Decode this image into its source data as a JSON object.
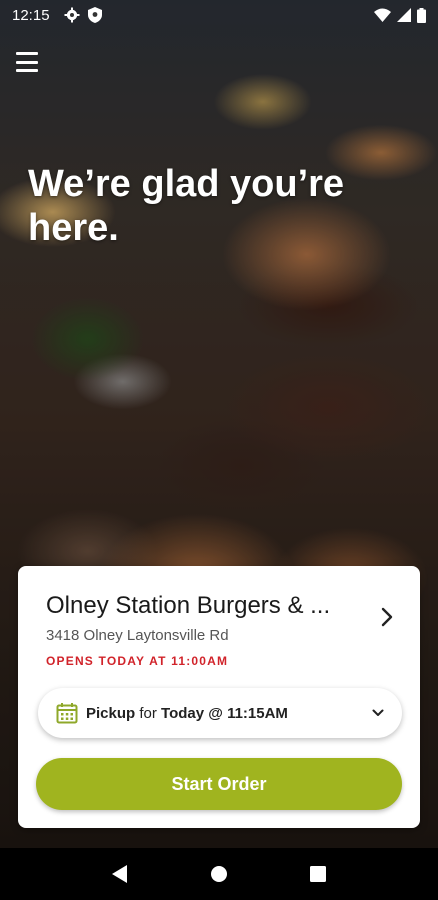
{
  "status_bar": {
    "time": "12:15",
    "left_icons": [
      "gear-icon",
      "shield-icon"
    ],
    "right_icons": [
      "wifi-icon",
      "signal-icon",
      "battery-icon"
    ]
  },
  "header": {
    "menu_icon": "hamburger-menu-icon"
  },
  "hero": {
    "welcome_line1": "We’re glad you’re",
    "welcome_line2": "here."
  },
  "store": {
    "name": "Olney Station Burgers & ...",
    "address": "3418 Olney Laytonsville Rd",
    "hours_status": "OPENS TODAY AT 11:00AM"
  },
  "pickup": {
    "mode": "Pickup",
    "connector": "for",
    "time": "Today @ 11:15AM"
  },
  "actions": {
    "start_order": "Start Order"
  },
  "colors": {
    "accent_green": "#a0b41f",
    "hours_red": "#d1232a",
    "calendar_green": "#8fa82a"
  },
  "nav_bar": {
    "icons": [
      "back-icon",
      "home-icon",
      "recents-icon"
    ]
  }
}
